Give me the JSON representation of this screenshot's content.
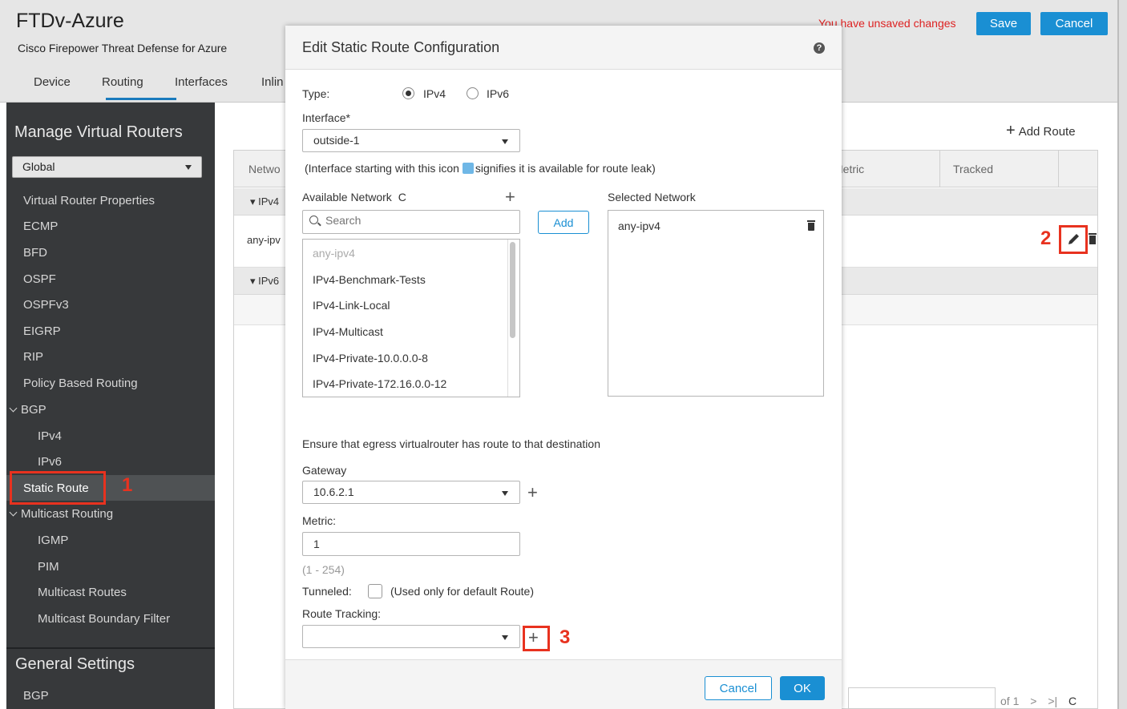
{
  "app": {
    "title": "FTDv-Azure",
    "subtitle": "Cisco Firepower Threat Defense for Azure",
    "tabs": [
      "Device",
      "Routing",
      "Interfaces",
      "Inlin"
    ],
    "active_tab": "Routing",
    "unsaved_text": "You have unsaved changes",
    "save_label": "Save",
    "cancel_label": "Cancel"
  },
  "sidebar": {
    "title": "Manage Virtual Routers",
    "router_select": "Global",
    "items": {
      "virtual_router_properties": "Virtual Router Properties",
      "ecmp": "ECMP",
      "bfd": "BFD",
      "ospf": "OSPF",
      "ospfv3": "OSPFv3",
      "eigrp": "EIGRP",
      "rip": "RIP",
      "pbr": "Policy Based Routing",
      "bgp": "BGP",
      "bgp_ipv4": "IPv4",
      "bgp_ipv6": "IPv6",
      "static_route": "Static Route",
      "multicast_routing": "Multicast Routing",
      "igmp": "IGMP",
      "pim": "PIM",
      "multicast_routes": "Multicast Routes",
      "multicast_boundary": "Multicast Boundary Filter"
    },
    "general_settings_title": "General Settings",
    "general_bgp": "BGP"
  },
  "main": {
    "add_route_label": "Add Route",
    "columns": {
      "network": "Netwo",
      "metric": "Metric",
      "tracked": "Tracked"
    },
    "groups": {
      "ipv4": "IPv4",
      "ipv6": "IPv6"
    },
    "row_network": "any-ipv",
    "pager": "of 1"
  },
  "markers": {
    "one": "1",
    "two": "2",
    "three": "3"
  },
  "modal": {
    "title": "Edit Static Route Configuration",
    "type_label": "Type:",
    "ipv4_label": "IPv4",
    "ipv6_label": "IPv6",
    "selected_type": "IPv4",
    "interface_label": "Interface*",
    "interface_value": "outside-1",
    "leak_note_before": "(Interface starting with this icon",
    "leak_note_after": "signifies it is available for route leak)",
    "available_network_label": "Available Network",
    "search_placeholder": "Search",
    "add_button": "Add",
    "selected_network_label": "Selected Network",
    "selected_networks": [
      "any-ipv4"
    ],
    "available_networks": [
      "any-ipv4",
      "IPv4-Benchmark-Tests",
      "IPv4-Link-Local",
      "IPv4-Multicast",
      "IPv4-Private-10.0.0.0-8",
      "IPv4-Private-172.16.0.0-12"
    ],
    "egress_note": "Ensure that egress virtualrouter has route to that destination",
    "gateway_label": "Gateway",
    "gateway_value": "10.6.2.1",
    "metric_label": "Metric:",
    "metric_value": "1",
    "metric_range": "(1 - 254)",
    "tunneled_label": "Tunneled:",
    "tunneled_note": "(Used only for default Route)",
    "route_tracking_label": "Route Tracking:",
    "cancel_label": "Cancel",
    "ok_label": "OK"
  }
}
